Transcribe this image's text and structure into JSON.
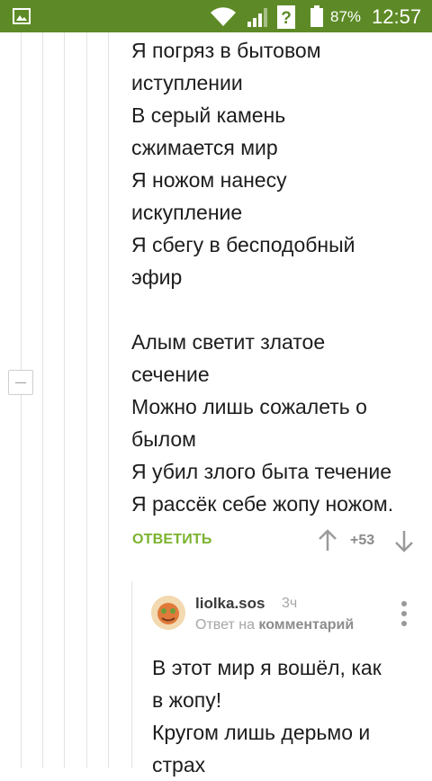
{
  "status_bar": {
    "battery_percent": "87%",
    "time": "12:57",
    "battery_level": 0.87,
    "icons": [
      "image-icon",
      "wifi-icon",
      "signal-icon",
      "unknown-network-icon",
      "battery-icon"
    ]
  },
  "comment": {
    "poem_lines": [
      "Я погряз в бытовом",
      "иступлении",
      "В серый камень",
      "сжимается мир",
      "Я ножом нанесу",
      "искупление",
      "Я сбегу в бесподобный",
      "эфир",
      "",
      "Алым светит златое",
      "сечение",
      "Можно лишь сожалеть о",
      "былом",
      "Я убил злого быта течение",
      "Я рассёк себе жопу ножом."
    ],
    "reply_label": "ОТВЕТИТЬ",
    "rating": "+53"
  },
  "reply": {
    "username": "liolka.sos",
    "time_ago": "3ч",
    "reply_to_prefix": "Ответ на",
    "reply_to_target": "комментарий",
    "text_lines": [
      "В этот мир я вошёл, как",
      "в жопу!",
      "Кругом лишь дерьмо и",
      "страх"
    ]
  },
  "colors": {
    "status_bar": "#5d8a26",
    "accent_green": "#7ab32e"
  }
}
